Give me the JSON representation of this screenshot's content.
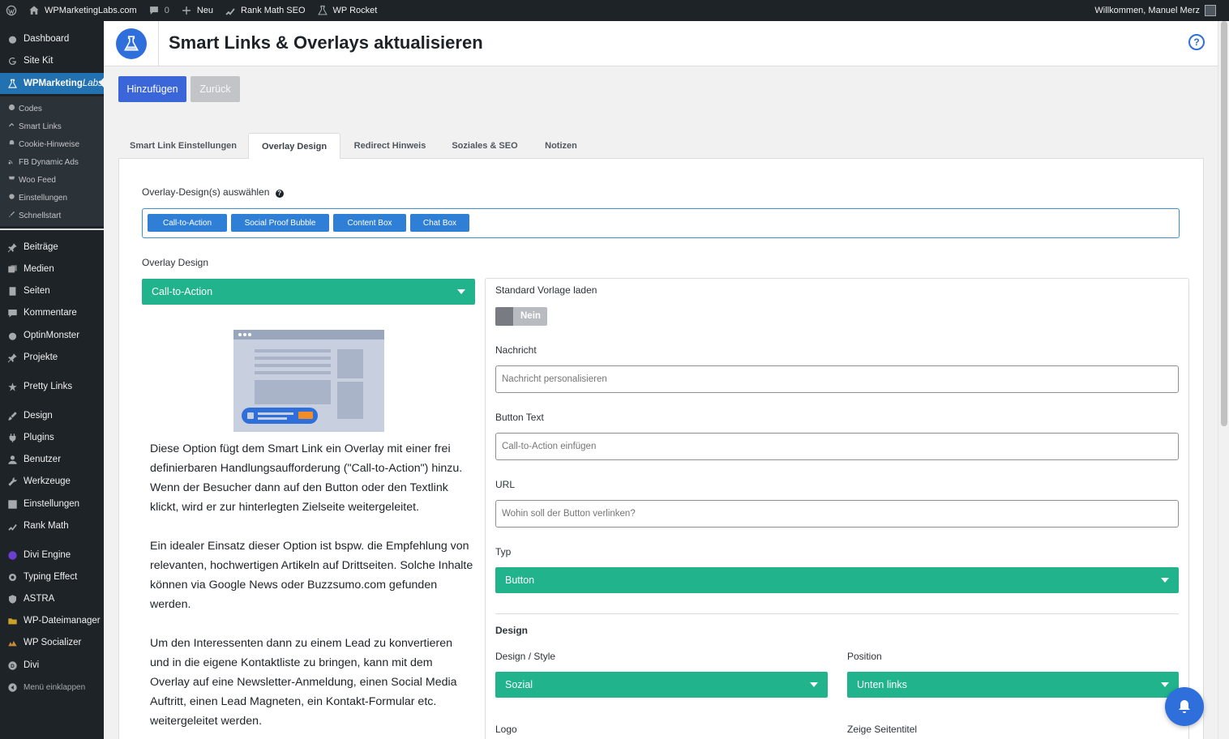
{
  "adminbar": {
    "site_name": "WPMarketingLabs.com",
    "comments_count": "0",
    "new_label": "Neu",
    "rank_math_label": "Rank Math SEO",
    "wp_rocket_label": "WP Rocket",
    "welcome": "Willkommen, Manuel Merz"
  },
  "sidebar": {
    "items": [
      {
        "label": "Dashboard",
        "icon": "dashboard-icon"
      },
      {
        "label": "Site Kit",
        "icon": "google-g-icon"
      },
      {
        "label": "WPMarketing",
        "label_em": "Labs",
        "icon": "flask-icon"
      },
      {
        "label": "Beiträge",
        "icon": "pin-icon"
      },
      {
        "label": "Medien",
        "icon": "media-icon"
      },
      {
        "label": "Seiten",
        "icon": "pages-icon"
      },
      {
        "label": "Kommentare",
        "icon": "comment-icon"
      },
      {
        "label": "OptinMonster",
        "icon": "monster-icon"
      },
      {
        "label": "Projekte",
        "icon": "pin-icon"
      },
      {
        "label": "Pretty Links",
        "icon": "star-icon"
      },
      {
        "label": "Design",
        "icon": "brush-icon"
      },
      {
        "label": "Plugins",
        "icon": "plugin-icon"
      },
      {
        "label": "Benutzer",
        "icon": "user-icon"
      },
      {
        "label": "Werkzeuge",
        "icon": "wrench-icon"
      },
      {
        "label": "Einstellungen",
        "icon": "settings-icon"
      },
      {
        "label": "Rank Math",
        "icon": "chart-icon"
      },
      {
        "label": "Divi Engine",
        "icon": "divi-engine-icon"
      },
      {
        "label": "Typing Effect",
        "icon": "gear-icon"
      },
      {
        "label": "ASTRA",
        "icon": "shield-icon"
      },
      {
        "label": "WP-Dateimanager",
        "icon": "folder-icon"
      },
      {
        "label": "WP Socializer",
        "icon": "socializer-icon"
      },
      {
        "label": "Divi",
        "icon": "divi-icon"
      }
    ],
    "submenu": [
      {
        "label": "Codes"
      },
      {
        "label": "Smart Links"
      },
      {
        "label": "Cookie-Hinweise"
      },
      {
        "label": "FB Dynamic Ads"
      },
      {
        "label": "Woo Feed"
      },
      {
        "label": "Einstellungen"
      },
      {
        "label": "Schnellstart"
      }
    ],
    "collapse_label": "Menü einklappen"
  },
  "header": {
    "title": "Smart Links & Overlays aktualisieren",
    "help": "?"
  },
  "actions": {
    "add": "Hinzufügen",
    "back": "Zurück"
  },
  "tabs": [
    "Smart Link Einstellungen",
    "Overlay Design",
    "Redirect Hinweis",
    "Soziales & SEO",
    "Notizen"
  ],
  "overlay": {
    "select_label": "Overlay-Design(s) auswählen",
    "help_mark": "?",
    "design_options": [
      "Call-to-Action",
      "Social Proof Bubble",
      "Content Box",
      "Chat Box"
    ],
    "design_label": "Overlay Design",
    "design_value": "Call-to-Action",
    "description": [
      "Diese Option fügt dem Smart Link ein Overlay mit einer frei definierbaren Handlungsaufforderung (\"Call-to-Action\") hinzu. Wenn der Besucher dann auf den Button oder den Textlink klickt, wird er zur hinterlegten Zielseite weitergeleitet.",
      "Ein idealer Einsatz dieser Option ist bspw. die Empfehlung von relevanten, hochwertigen Artikeln auf Drittseiten. Solche Inhalte können via Google News oder Buzzsumo.com gefunden werden.",
      "Um den Interessenten dann zu einem Lead zu konvertieren und in die eigene Kontaktliste zu bringen, kann mit dem Overlay auf eine Newsletter-Anmeldung, einen Social Media Auftritt, einen Lead Magneten, ein Kontakt-Formular etc. weitergeleitet werden."
    ]
  },
  "settings": {
    "template_label": "Standard Vorlage laden",
    "template_toggle": "Nein",
    "message_label": "Nachricht",
    "message_placeholder": "Nachricht personalisieren",
    "button_text_label": "Button Text",
    "button_text_placeholder": "Call-to-Action einfügen",
    "url_label": "URL",
    "url_placeholder": "Wohin soll der Button verlinken?",
    "type_label": "Typ",
    "type_value": "Button",
    "design_heading": "Design",
    "style_label": "Design / Style",
    "style_value": "Sozial",
    "position_label": "Position",
    "position_value": "Unten links",
    "logo_label": "Logo",
    "show_title_label": "Zeige Seitentitel"
  },
  "colors": {
    "accent_blue": "#3b66d9",
    "select_green": "#20b38c",
    "sidebar_dark": "#1d2327",
    "active_menu": "#2271b1"
  }
}
